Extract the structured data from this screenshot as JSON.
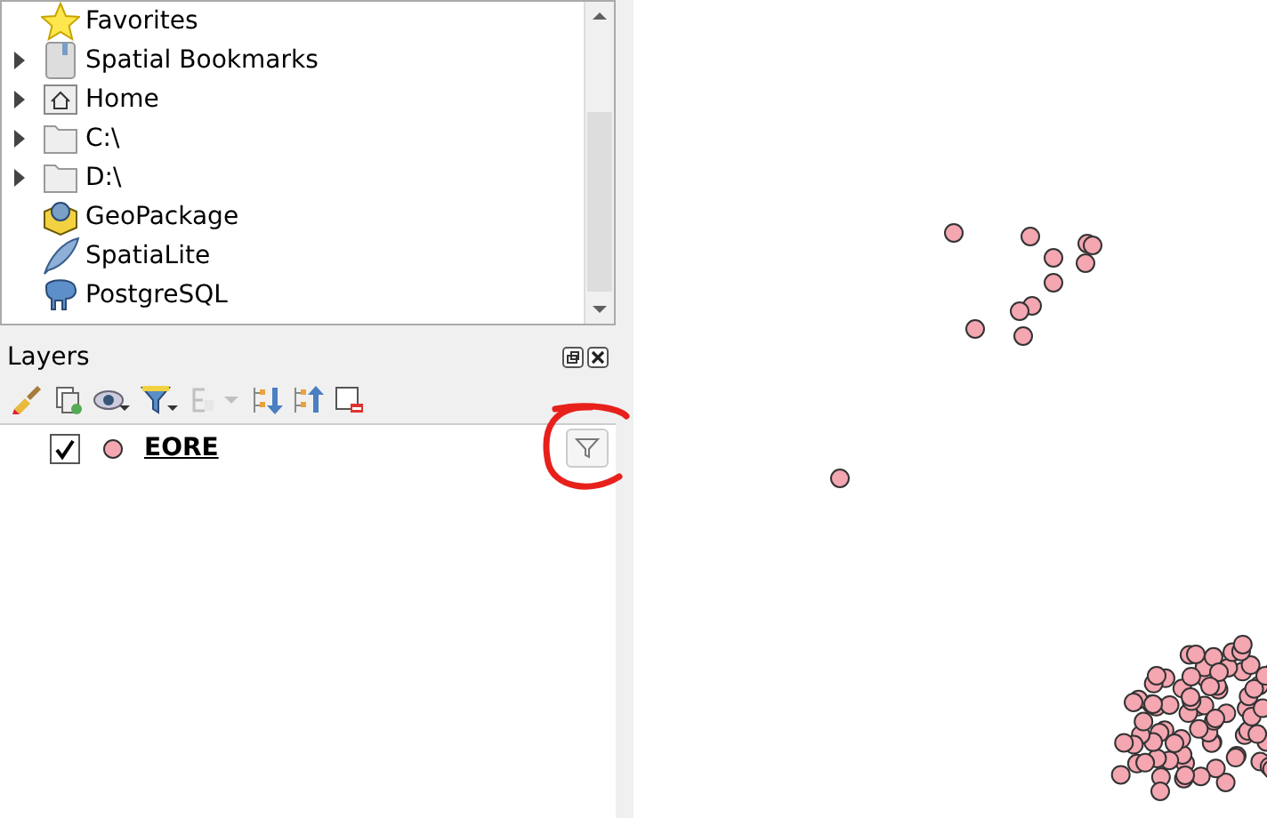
{
  "browser": {
    "items": [
      {
        "label": "Favorites",
        "kind": "star",
        "expandable": false
      },
      {
        "label": "Spatial Bookmarks",
        "kind": "bookmark",
        "expandable": true
      },
      {
        "label": "Home",
        "kind": "home",
        "expandable": true
      },
      {
        "label": "C:\\",
        "kind": "folder",
        "expandable": true
      },
      {
        "label": "D:\\",
        "kind": "folder",
        "expandable": true
      },
      {
        "label": "GeoPackage",
        "kind": "geopackage",
        "expandable": false
      },
      {
        "label": "SpatiaLite",
        "kind": "feather",
        "expandable": false
      },
      {
        "label": "PostgreSQL",
        "kind": "elephant",
        "expandable": false
      }
    ]
  },
  "layers_panel": {
    "title": "Layers",
    "toolbar": [
      {
        "kind": "style",
        "disabled": false
      },
      {
        "kind": "add-group",
        "disabled": false
      },
      {
        "kind": "visibility",
        "disabled": false
      },
      {
        "kind": "filter",
        "disabled": false
      },
      {
        "kind": "expression",
        "disabled": true
      },
      {
        "kind": "expand",
        "disabled": false
      },
      {
        "kind": "collapse",
        "disabled": false
      },
      {
        "kind": "remove",
        "disabled": false
      }
    ],
    "layers": [
      {
        "name": "EORE",
        "checked": true,
        "color": "#f4a6b1",
        "filtered": true
      }
    ]
  }
}
